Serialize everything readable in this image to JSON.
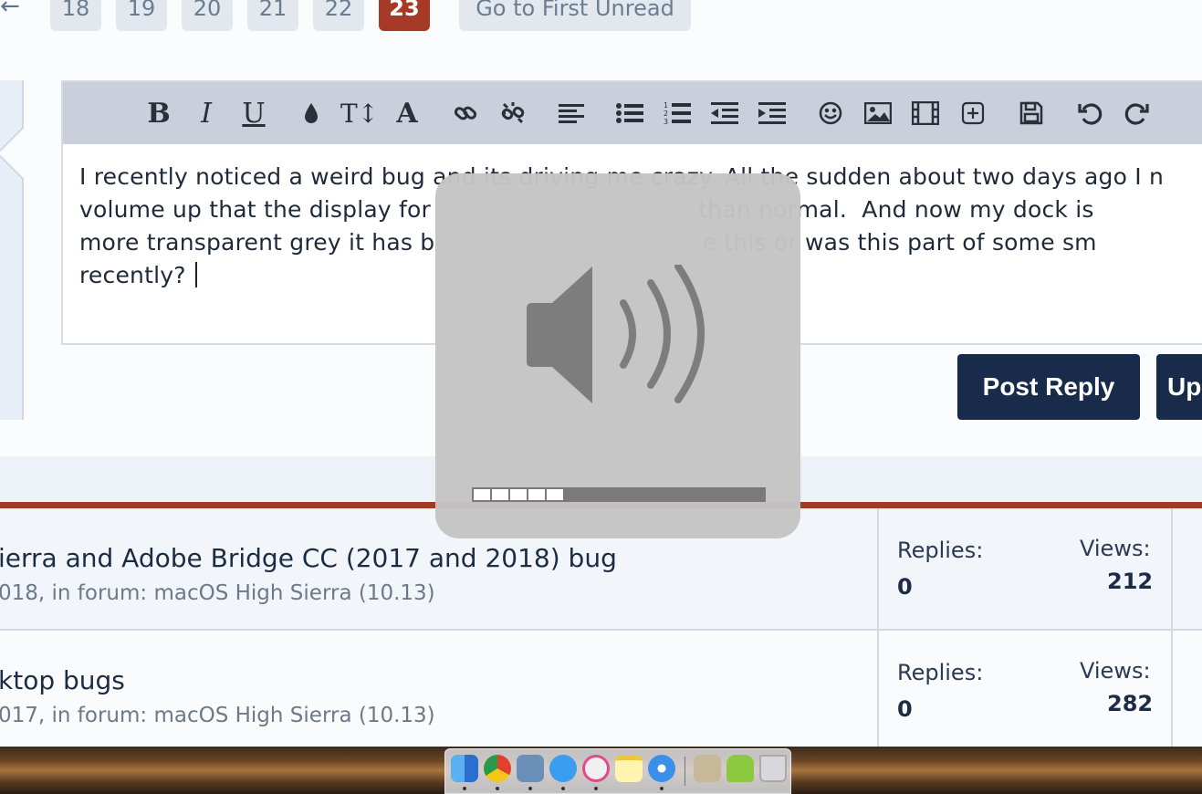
{
  "pagination": {
    "prev_arrow": "←",
    "pages": [
      "18",
      "19",
      "20",
      "21",
      "22",
      "23"
    ],
    "current_page": "23",
    "first_unread_label": "Go to First Unread"
  },
  "editor": {
    "toolbar": {
      "bold": "B",
      "italic": "I",
      "underline": "U",
      "font_size": "T↕",
      "font_family": "A",
      "items": [
        "bold",
        "italic",
        "underline",
        "color",
        "font-size",
        "font-family",
        "link",
        "unlink",
        "align",
        "bullet-list",
        "numbered-list",
        "outdent",
        "indent",
        "smilies",
        "image",
        "media",
        "insert",
        "save-draft",
        "undo",
        "redo"
      ]
    },
    "lines": [
      "I recently noticed a weird bug and its driving me crazy.  All the sudden about two days ago I n",
      "volume up that the display for                                    than normal.  And now my dock is",
      "more transparent grey it has b                                    e this or was this part of some sm",
      "recently?"
    ]
  },
  "buttons": {
    "post_reply": "Post Reply",
    "upload": "Up"
  },
  "threads": [
    {
      "title": "ierra and Adobe Bridge CC (2017 and 2018) bug",
      "meta": "018, in forum: macOS High Sierra (10.13)",
      "replies_label": "Replies:",
      "replies": "0",
      "views_label": "Views:",
      "views": "212"
    },
    {
      "title": "ktop bugs",
      "meta": "017, in forum: macOS High Sierra (10.13)",
      "replies_label": "Replies:",
      "replies": "0",
      "views_label": "Views:",
      "views": "282"
    }
  ],
  "volume_hud": {
    "level_segments": 5,
    "total_segments": 16,
    "icon": "speaker-volume-icon"
  },
  "dock": {
    "apps": [
      "finder-icon",
      "chrome-icon",
      "preview-icon",
      "messages-icon",
      "itunes-icon",
      "notes-icon",
      "safari-icon",
      "downloads-icon",
      "android-file-transfer-icon",
      "trash-icon"
    ]
  },
  "colors": {
    "current_page": "#a73a26",
    "button": "#182b4a",
    "list_border": "#a33a27"
  }
}
